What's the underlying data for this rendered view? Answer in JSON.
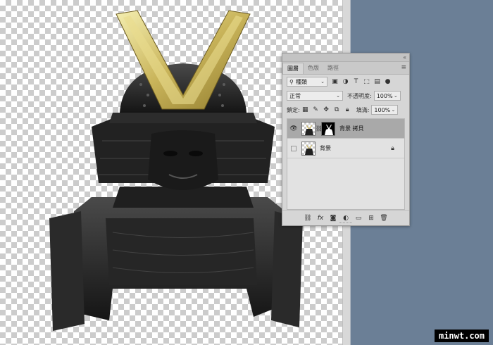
{
  "panel": {
    "tabs": [
      {
        "label": "圖層",
        "active": true
      },
      {
        "label": "色版",
        "active": false
      },
      {
        "label": "路徑",
        "active": false
      }
    ],
    "filter": {
      "kind": "種類"
    },
    "blend_mode": "正常",
    "opacity_label": "不透明度:",
    "opacity_value": "100%",
    "lock_label": "鎖定:",
    "fill_label": "填滿:",
    "fill_value": "100%",
    "layers": [
      {
        "name": "背景 拷貝",
        "visible": true,
        "selected": true,
        "has_mask": true,
        "locked": false
      },
      {
        "name": "背景",
        "visible": false,
        "selected": false,
        "has_mask": false,
        "locked": true
      }
    ]
  },
  "watermark": "minwt.com",
  "colors": {
    "workspace": "#6b7f96",
    "panel": "#d6d6d6",
    "selected_layer": "#a9a9a9"
  }
}
